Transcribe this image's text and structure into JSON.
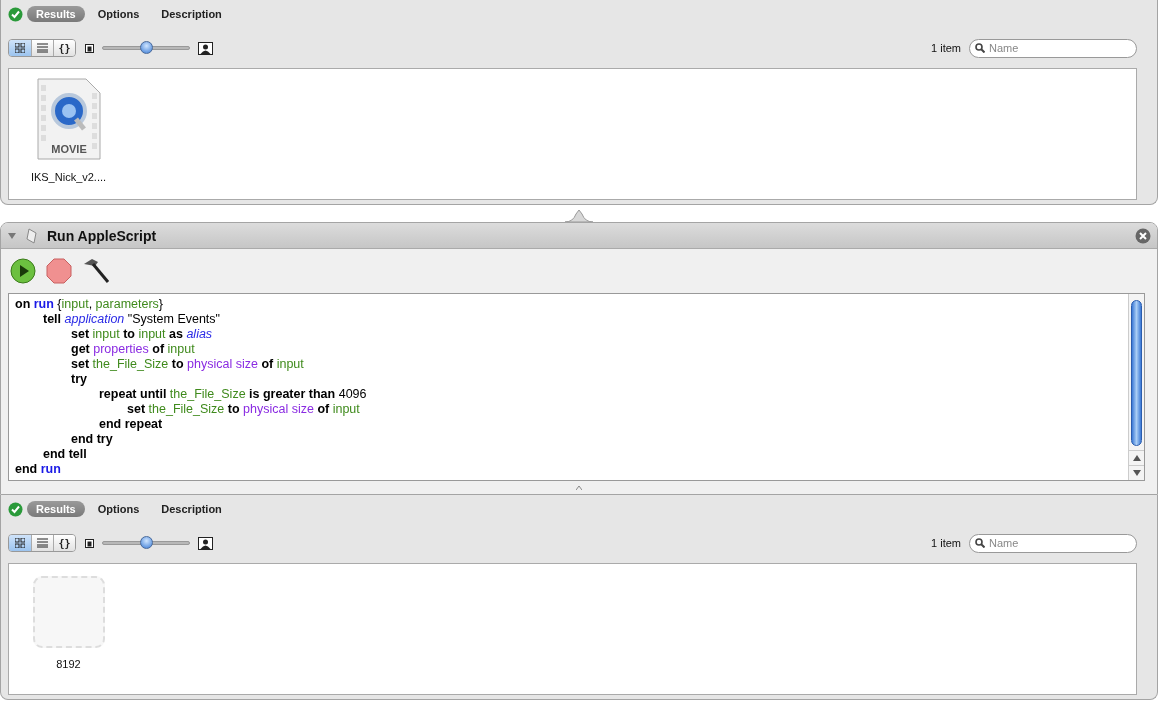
{
  "results_panels": [
    {
      "tabs": [
        {
          "label": "Results",
          "selected": true
        },
        {
          "label": "Options",
          "selected": false
        },
        {
          "label": "Description",
          "selected": false
        }
      ],
      "view_buttons": [
        {
          "kind": "grid",
          "selected": true
        },
        {
          "kind": "list",
          "selected": false
        },
        {
          "kind": "braces",
          "label": "{}",
          "selected": false
        }
      ],
      "size_slider": {
        "level": 0.5
      },
      "item_count": "1 item",
      "search": {
        "placeholder": "Name"
      },
      "items": [
        {
          "kind": "movie",
          "badge": "MOVIE",
          "name": "IKS_Nick_v2...."
        }
      ]
    },
    {
      "tabs": [
        {
          "label": "Results",
          "selected": true
        },
        {
          "label": "Options",
          "selected": false
        },
        {
          "label": "Description",
          "selected": false
        }
      ],
      "view_buttons": [
        {
          "kind": "grid",
          "selected": true
        },
        {
          "kind": "list",
          "selected": false
        },
        {
          "kind": "braces",
          "label": "{}",
          "selected": false
        }
      ],
      "size_slider": {
        "level": 0.5
      },
      "item_count": "1 item",
      "search": {
        "placeholder": "Name"
      },
      "items": [
        {
          "kind": "placeholder",
          "name": "8192"
        }
      ]
    }
  ],
  "action": {
    "title": "Run AppleScript",
    "expanded": true,
    "script": [
      {
        "tokens": [
          {
            "text": "on ",
            "kind": "keyword"
          },
          {
            "text": "run ",
            "kind": "handler"
          },
          {
            "text": "{",
            "kind": "text"
          },
          {
            "text": "input",
            "kind": "variable"
          },
          {
            "text": ", ",
            "kind": "text"
          },
          {
            "text": "parameters",
            "kind": "variable"
          },
          {
            "text": "}",
            "kind": "text"
          }
        ],
        "children": [
          {
            "tokens": [
              {
                "text": "tell ",
                "kind": "keyword"
              },
              {
                "text": "application ",
                "kind": "class"
              },
              {
                "text": "\"System Events\"",
                "kind": "text"
              }
            ],
            "children": [
              {
                "tokens": [
                  {
                    "text": "set ",
                    "kind": "keyword"
                  },
                  {
                    "text": "input ",
                    "kind": "variable"
                  },
                  {
                    "text": "to ",
                    "kind": "keyword"
                  },
                  {
                    "text": "input ",
                    "kind": "variable"
                  },
                  {
                    "text": "as ",
                    "kind": "keyword"
                  },
                  {
                    "text": "alias",
                    "kind": "class"
                  }
                ]
              },
              {
                "tokens": [
                  {
                    "text": "get ",
                    "kind": "keyword"
                  },
                  {
                    "text": "properties ",
                    "kind": "property"
                  },
                  {
                    "text": "of ",
                    "kind": "keyword"
                  },
                  {
                    "text": "input",
                    "kind": "variable"
                  }
                ]
              },
              {
                "tokens": [
                  {
                    "text": "set ",
                    "kind": "keyword"
                  },
                  {
                    "text": "the_File_Size ",
                    "kind": "variable"
                  },
                  {
                    "text": "to ",
                    "kind": "keyword"
                  },
                  {
                    "text": "physical size ",
                    "kind": "property"
                  },
                  {
                    "text": "of ",
                    "kind": "keyword"
                  },
                  {
                    "text": "input",
                    "kind": "variable"
                  }
                ]
              },
              {
                "tokens": [
                  {
                    "text": "try",
                    "kind": "keyword"
                  }
                ],
                "children": [
                  {
                    "tokens": [
                      {
                        "text": "repeat until ",
                        "kind": "keyword"
                      },
                      {
                        "text": "the_File_Size ",
                        "kind": "variable"
                      },
                      {
                        "text": "is greater than ",
                        "kind": "keyword"
                      },
                      {
                        "text": "4096",
                        "kind": "text"
                      }
                    ],
                    "children": [
                      {
                        "tokens": [
                          {
                            "text": "set ",
                            "kind": "keyword"
                          },
                          {
                            "text": "the_File_Size ",
                            "kind": "variable"
                          },
                          {
                            "text": "to ",
                            "kind": "keyword"
                          },
                          {
                            "text": "physical size ",
                            "kind": "property"
                          },
                          {
                            "text": "of ",
                            "kind": "keyword"
                          },
                          {
                            "text": "input",
                            "kind": "variable"
                          }
                        ]
                      }
                    ]
                  },
                  {
                    "tokens": [
                      {
                        "text": "end repeat",
                        "kind": "keyword"
                      }
                    ]
                  }
                ]
              },
              {
                "tokens": [
                  {
                    "text": "end try",
                    "kind": "keyword"
                  }
                ]
              }
            ]
          },
          {
            "tokens": [
              {
                "text": "end tell",
                "kind": "keyword"
              }
            ]
          }
        ]
      },
      {
        "tokens": [
          {
            "text": "end ",
            "kind": "keyword"
          },
          {
            "text": "run",
            "kind": "handler"
          }
        ]
      }
    ]
  }
}
